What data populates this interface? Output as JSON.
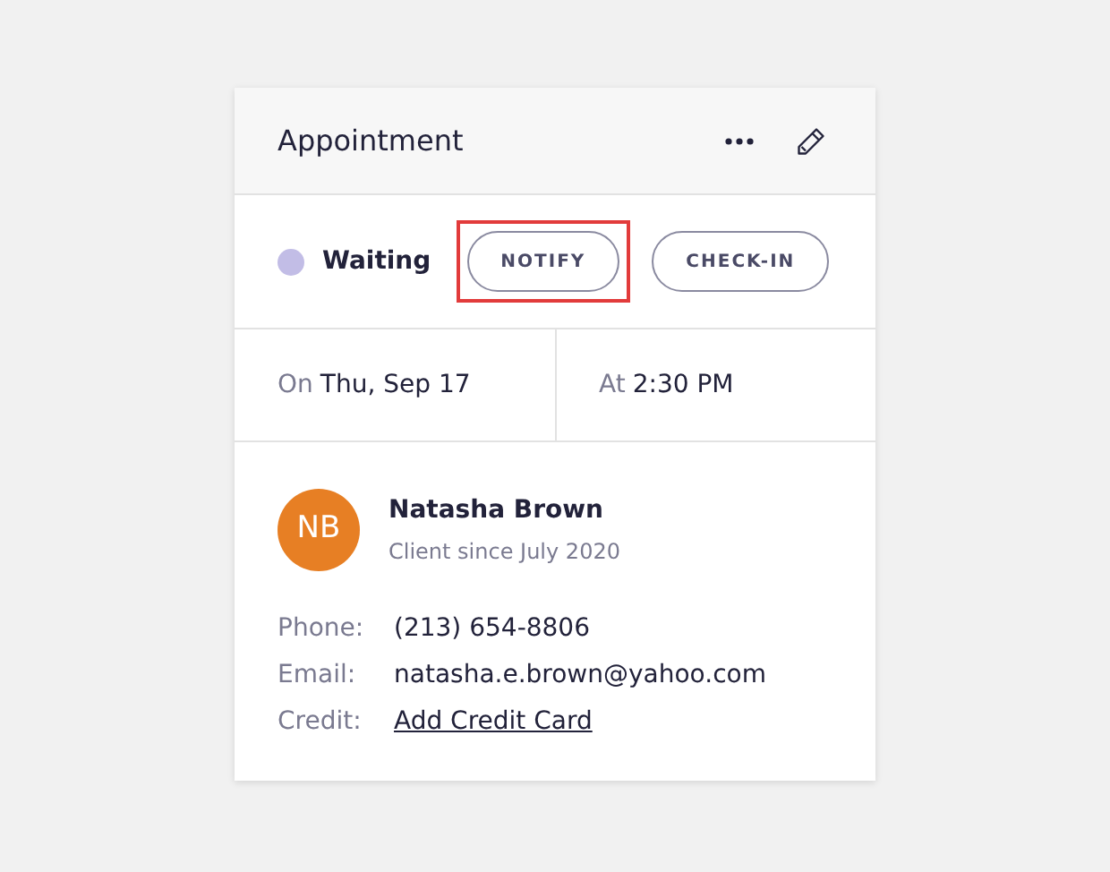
{
  "card": {
    "title": "Appointment"
  },
  "status": {
    "label": "Waiting",
    "color": "#c2bde6"
  },
  "actions": [
    {
      "label": "NOTIFY",
      "highlighted": true
    },
    {
      "label": "CHECK-IN",
      "highlighted": false
    }
  ],
  "schedule": [
    {
      "prefix": "On",
      "value": "Thu, Sep 17"
    },
    {
      "prefix": "At",
      "value": "2:30 PM"
    }
  ],
  "client": {
    "initials": "NB",
    "name": "Natasha Brown",
    "since": "Client since July 2020"
  },
  "details": [
    {
      "kind": "text",
      "label": "Phone:",
      "value": "(213) 654-8806"
    },
    {
      "kind": "text",
      "label": "Email:",
      "value": "natasha.e.brown@yahoo.com"
    },
    {
      "kind": "link",
      "label": "Credit:",
      "value": "Add Credit Card"
    }
  ]
}
